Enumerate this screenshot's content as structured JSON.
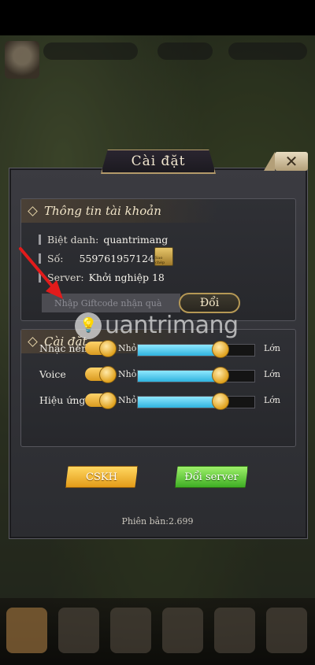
{
  "dialog": {
    "title": "Cài đặt",
    "close_glyph": "✕"
  },
  "account": {
    "section_title": "Thông tin tài khoản",
    "nickname_label": "Biệt danh:",
    "nickname_value": "quantrimang",
    "number_label": "Số:",
    "number_value": "559761957124097",
    "copy_label": "Sao chép",
    "server_label": "Server:",
    "server_value": "Khởi nghiệp 18",
    "giftcode_placeholder": "Nhập Giftcode nhận quà",
    "redeem_label": "Đổi"
  },
  "settings": {
    "section_title": "Cài đặt",
    "small_label": "Nhỏ",
    "large_label": "Lớn",
    "rows": [
      {
        "label": "Nhạc nền",
        "level": 0.7,
        "enabled": true
      },
      {
        "label": "Voice",
        "level": 0.7,
        "enabled": true
      },
      {
        "label": "Hiệu ứng",
        "level": 0.7,
        "enabled": true
      }
    ]
  },
  "footer": {
    "support_label": "CSKH",
    "change_server_label": "Đổi server",
    "version_text": "Phiên bản:2.699"
  },
  "watermark": {
    "text": "uantrimang"
  },
  "colors": {
    "accent_gold": "#e0a21f",
    "slider_fill": "#2fb3de",
    "server_green": "#3fae24",
    "arrow_red": "#e21b1b"
  },
  "icons": {
    "close": "close-icon",
    "copy": "copy-icon",
    "section": "diamond-icon",
    "watermark": "lightbulb-logo-icon",
    "annotation": "red-arrow-icon"
  }
}
